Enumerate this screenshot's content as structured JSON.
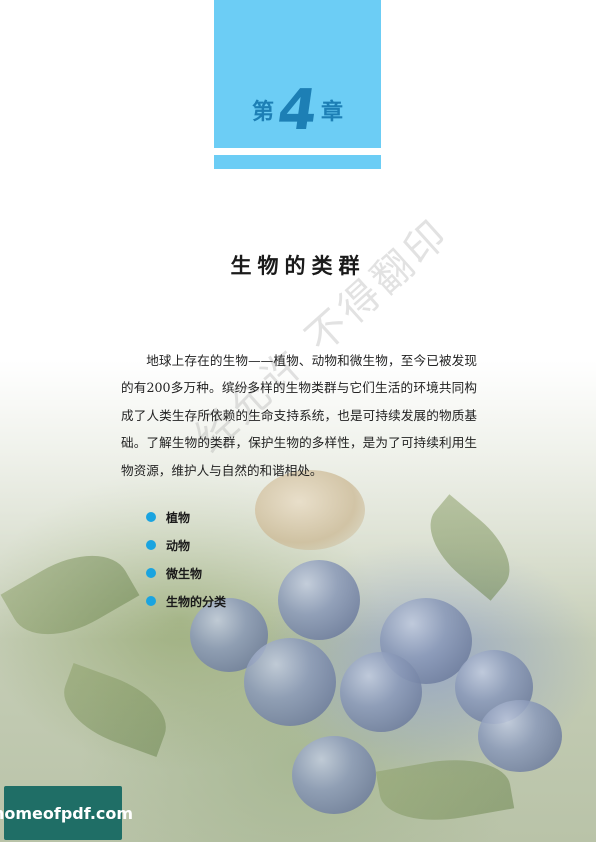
{
  "chapter": {
    "prefix": "第",
    "number": "4",
    "suffix": "章"
  },
  "title": "生物的类群",
  "intro": "地球上存在的生物——植物、动物和微生物，至今已被发现的有200多万种。缤纷多样的生物类群与它们生活的环境共同构成了人类生存所依赖的生命支持系统，也是可持续发展的物质基础。了解生物的类群，保护生物的多样性，是为了可持续利用生物资源，维护人与自然的和谐相处。",
  "sections": [
    "植物",
    "动物",
    "微生物",
    "生物的分类"
  ],
  "watermark": "经允许 不得翻印",
  "site_badge": "homeofpdf.com",
  "colors": {
    "chapter_block": "#6ccdf5",
    "chapter_text": "#1d7fb5",
    "bullet": "#1aa4e0",
    "badge": "#1f6e66"
  }
}
